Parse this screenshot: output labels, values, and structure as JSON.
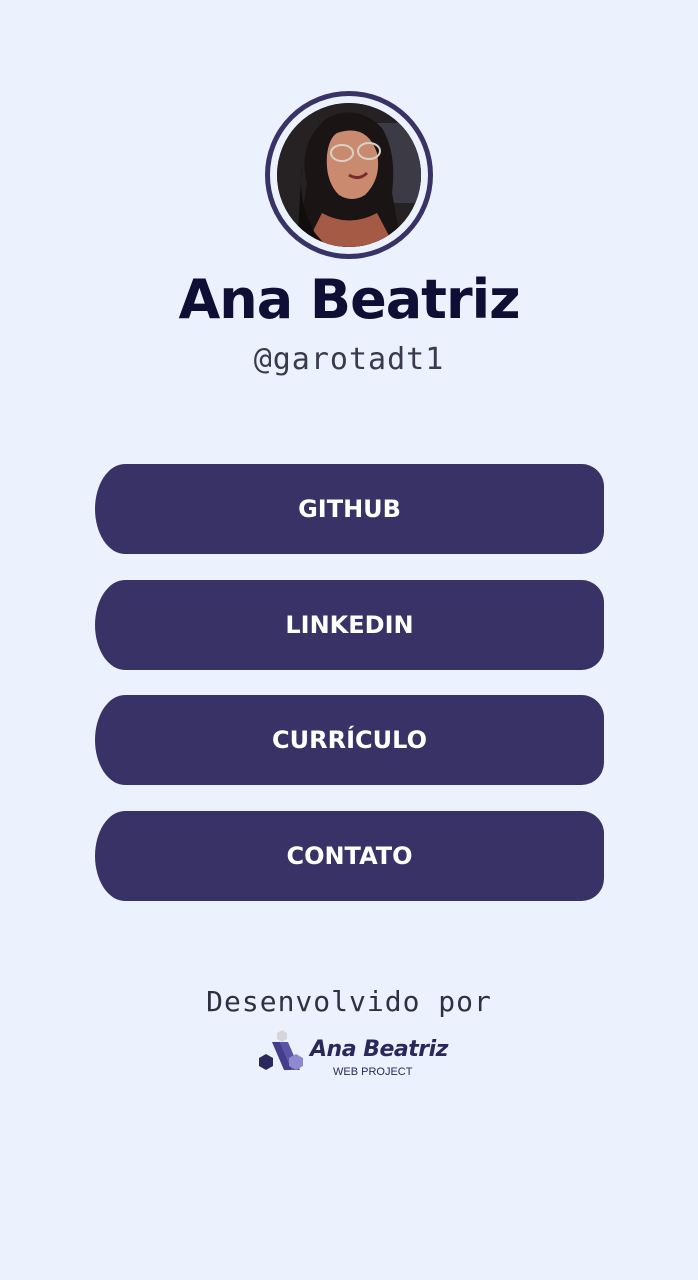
{
  "profile": {
    "name": "Ana Beatriz",
    "handle": "@garotadt1"
  },
  "links": [
    {
      "label": "GITHUB"
    },
    {
      "label": "LINKEDIN"
    },
    {
      "label": "CURRÍCULO"
    },
    {
      "label": "CONTATO"
    }
  ],
  "footer": {
    "credit_label": "Desenvolvido por",
    "brand": {
      "name": "Ana Beatriz",
      "subtitle": "WEB PROJECT"
    }
  },
  "colors": {
    "background": "#ecf2fd",
    "accent": "#383266",
    "name_text": "#0f0f35",
    "button_text": "#ffffff"
  }
}
